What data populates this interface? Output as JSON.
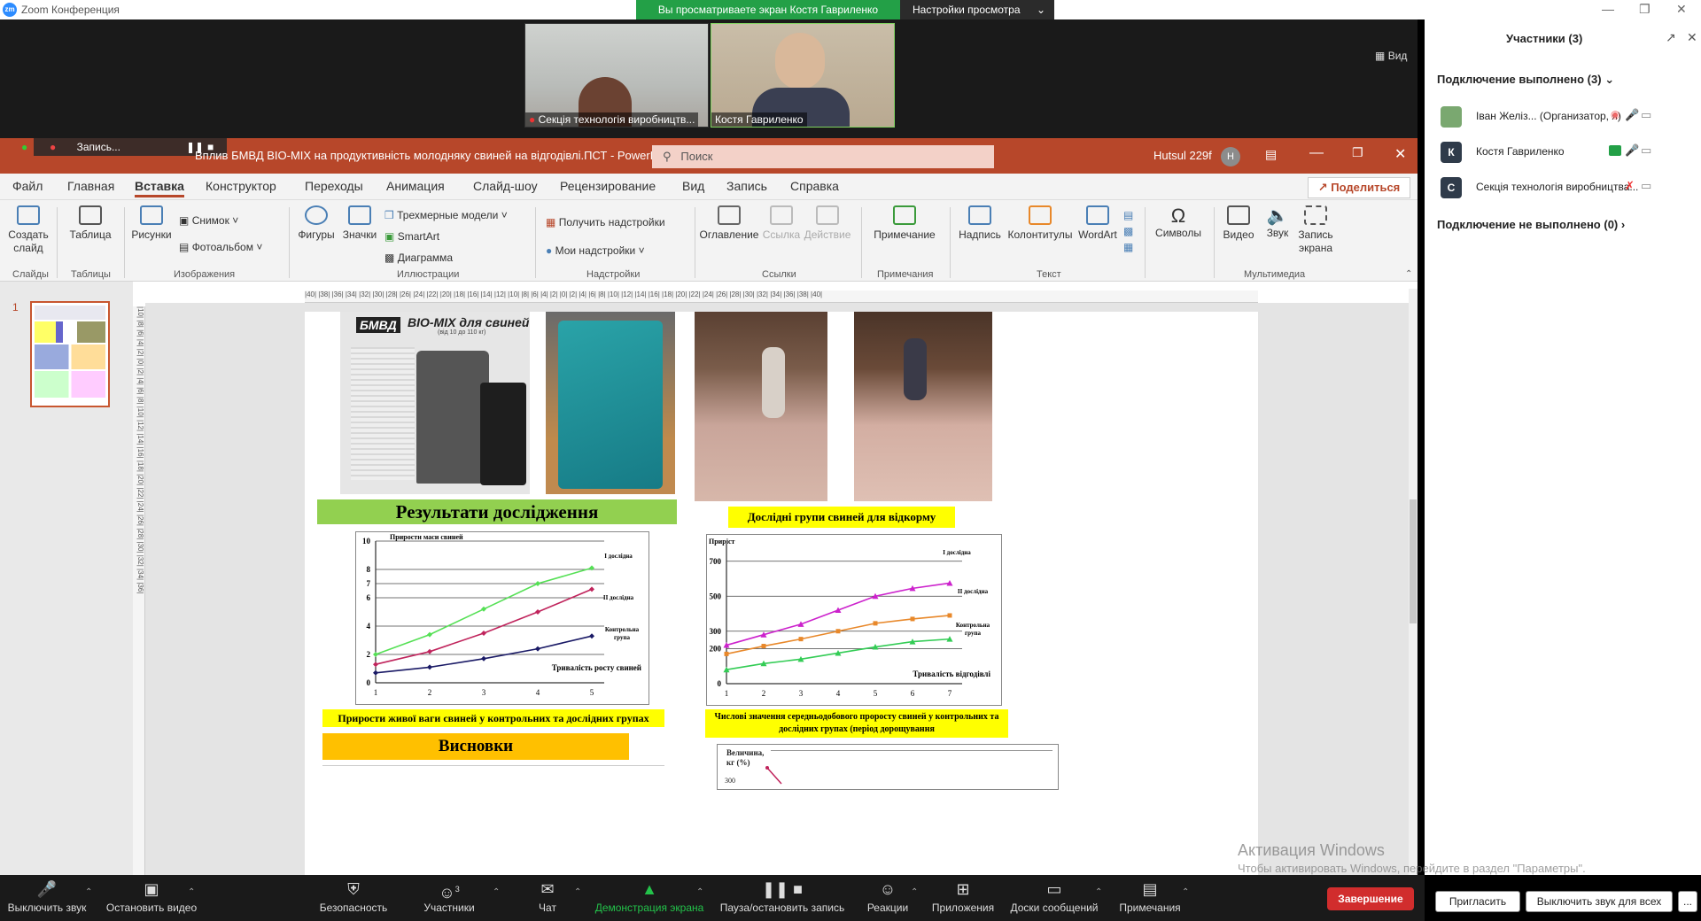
{
  "titlebar": {
    "app_title": "Zoom Конференция",
    "logo_text": "zm"
  },
  "banner": {
    "text": "Вы просматриваете экран Костя  Гавриленко",
    "view_settings": "Настройки просмотра"
  },
  "video": {
    "tiles": [
      {
        "label": "Секція технологія виробництв..."
      },
      {
        "label": "Костя  Гавриленко"
      }
    ],
    "view_label": "Вид"
  },
  "ppt": {
    "title": "Вплив БМВД ВІО-МІХ на продуктивність молодняку свиней на відгодівлі.ПСТ  -  PowerPoint",
    "search": "Поиск",
    "user": "Hutsul 229f",
    "user_initial": "Н",
    "recording": "Запись...",
    "menu": [
      "Файл",
      "Главная",
      "Вставка",
      "Конструктор",
      "Переходы",
      "Анимация",
      "Слайд-шоу",
      "Рецензирование",
      "Вид",
      "Запись",
      "Справка"
    ],
    "share": "Поделиться",
    "ribbon": {
      "new_slide": "Создать слайд",
      "table": "Таблица",
      "pictures": "Рисунки",
      "snapshot": "Снимок",
      "photo_album": "Фотоальбом",
      "shapes": "Фигуры",
      "icons": "Значки",
      "models3d": "Трехмерные модели",
      "smartart": "SmartArt",
      "diagram": "Диаграмма",
      "get_addins": "Получить надстройки",
      "my_addins": "Мои надстройки",
      "toc": "Оглавление",
      "link": "Ссылка",
      "action": "Действие",
      "comment": "Примечание",
      "textbox": "Надпись",
      "header_footer": "Колонтитулы",
      "wordart": "WordArt",
      "symbols": "Символы",
      "video": "Видео",
      "audio": "Звук",
      "screen_rec": "Запись экрана",
      "groups": {
        "slides": "Слайды",
        "tables": "Таблицы",
        "images": "Изображения",
        "illustrations": "Иллюстрации",
        "addins": "Надстройки",
        "links": "Ссылки",
        "comments": "Примечания",
        "text": "Текст",
        "multimedia": "Мультимедиа"
      }
    },
    "slide_number": "1",
    "hruler": "|40| |38| |36| |34| |32| |30| |28| |26| |24| |22| |20| |18| |16| |14| |12| |10| |8| |6| |4| |2| |0| |2| |4| |6| |8| |10| |12| |14| |16| |18| |20| |22| |24| |26| |28| |30| |32| |34| |36| |38| |40|",
    "vruler": "|10| |8| |6| |4| |2| |0| |2| |4| |6| |8| |10| |12| |14| |16| |18| |20| |22| |24| |26| |28| |30| |32| |34| |36|"
  },
  "slide": {
    "product_logo": "БМВД",
    "product_title": "ВІО-МІХ для свиней",
    "product_subtitle": "(від 10 до 110 кг)",
    "heading_results": "Результати дослідження",
    "heading_groups": "Дослідні групи свиней для відкорму",
    "caption_chart1": "Прирости живої ваги свиней у контрольних та дослідних групах",
    "caption_chart2": "Числові значення середньодобового проросту свиней у контрольних та дослідних групах (період дорощування",
    "heading_conclusions": "Висновки",
    "chart3_ylabel": "Величина, кг (%)",
    "chart3_ytick": "300"
  },
  "chart_data": [
    {
      "type": "line",
      "ylabel": "Прирости маси свиней",
      "xlabel": "Тривалість росту свиней",
      "x": [
        1,
        2,
        3,
        4,
        5
      ],
      "ylim": [
        0,
        10
      ],
      "yticks": [
        0,
        2,
        4,
        6,
        7,
        8,
        10
      ],
      "grid": true,
      "series": [
        {
          "name": "І дослідна",
          "color": "#55e055",
          "values": [
            2.0,
            3.4,
            5.2,
            7.0,
            8.1
          ]
        },
        {
          "name": "ІІ дослідна",
          "color": "#c0245c",
          "values": [
            1.3,
            2.2,
            3.5,
            5.0,
            6.6
          ]
        },
        {
          "name": "Контрольна група",
          "color": "#1a1a66",
          "values": [
            0.7,
            1.1,
            1.7,
            2.4,
            3.3
          ]
        }
      ]
    },
    {
      "type": "line",
      "ylabel": "Приріст",
      "xlabel": "Тривалість відгодівлі",
      "x": [
        1,
        2,
        3,
        4,
        5,
        6,
        7
      ],
      "ylim": [
        0,
        800
      ],
      "yticks": [
        0,
        200,
        300,
        500,
        700
      ],
      "grid": true,
      "series": [
        {
          "name": "І дослідна",
          "color": "#cc22cc",
          "values": [
            220,
            280,
            340,
            420,
            500,
            545,
            575
          ]
        },
        {
          "name": "ІІ дослідна",
          "color": "#e8882a",
          "values": [
            170,
            215,
            255,
            300,
            345,
            370,
            390
          ]
        },
        {
          "name": "Контрольна група",
          "color": "#33cc55",
          "values": [
            80,
            115,
            140,
            175,
            210,
            240,
            255
          ]
        }
      ]
    }
  ],
  "participants": {
    "title": "Участники (3)",
    "connected_header": "Подключение выполнено (3)",
    "list": [
      {
        "name": "Іван Желіз... (Организатор, я)",
        "initial": "",
        "avatar_color": "#7aa870"
      },
      {
        "name": "Костя  Гавриленко",
        "initial": "К",
        "avatar_color": "#2f3b4a"
      },
      {
        "name": "Секція технологія виробництва...",
        "initial": "С",
        "avatar_color": "#2f3b4a"
      }
    ],
    "not_connected_header": "Подключение не выполнено (0)",
    "invite": "Пригласить",
    "mute_all": "Выключить звук для всех",
    "more": "..."
  },
  "zoombar": {
    "mute": "Выключить звук",
    "stop_video": "Остановить видео",
    "security": "Безопасность",
    "participants": "Участники",
    "participants_count": "3",
    "chat": "Чат",
    "share_screen": "Демонстрация экрана",
    "pause_record": "Пауза/остановить запись",
    "reactions": "Реакции",
    "apps": "Приложения",
    "whiteboards": "Доски сообщений",
    "notes": "Примечания",
    "end": "Завершение"
  },
  "activation": {
    "title": "Активация Windows",
    "text": "Чтобы активировать Windows, перейдите в раздел \"Параметры\"."
  },
  "colors": {
    "zoom_blue": "#2d8cff",
    "ppt_red": "#b7472a",
    "share_green": "#23a047",
    "end_red": "#d12d2d",
    "slide_green": "#92d050",
    "slide_yellow": "#ffff00",
    "slide_orange": "#ffc000"
  }
}
